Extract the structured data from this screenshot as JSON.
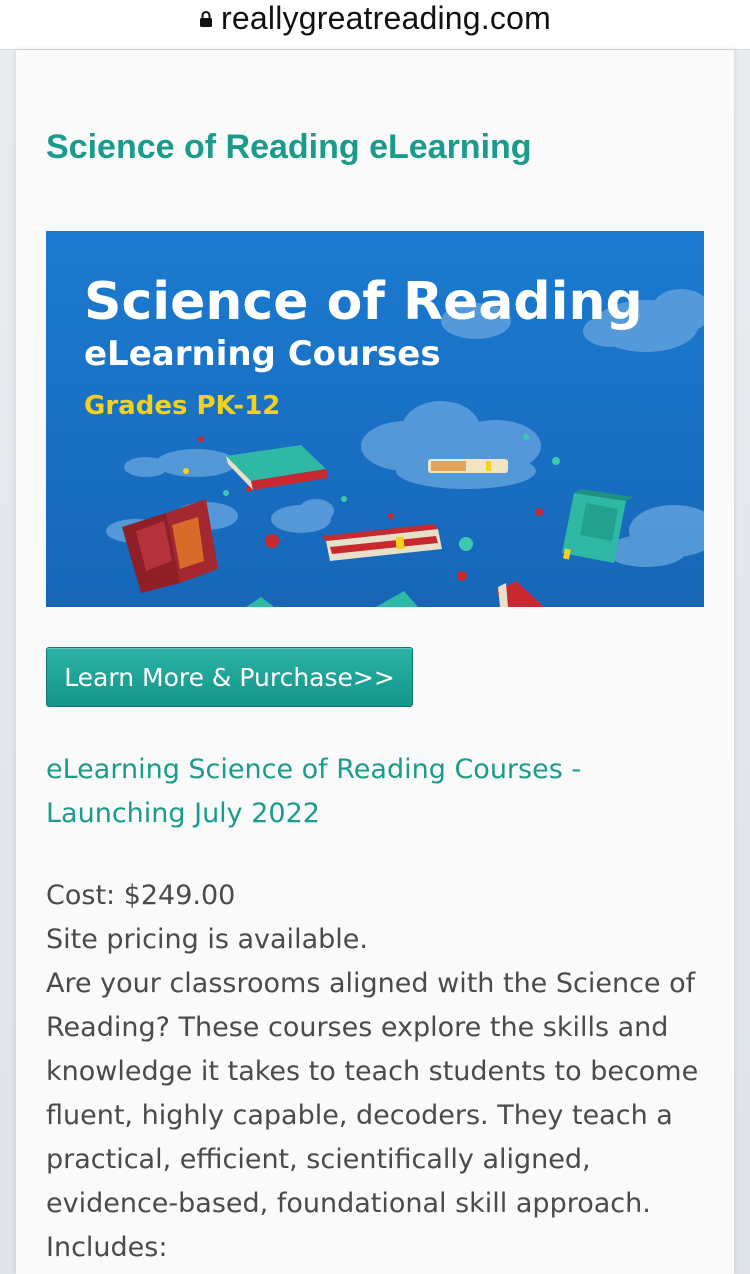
{
  "browser": {
    "url": "reallygreatreading.com"
  },
  "page": {
    "title": "Science of Reading eLearning",
    "banner": {
      "title_line1": "Science of Reading",
      "title_line2": "eLearning Courses",
      "grades": "Grades PK-12"
    },
    "cta_label": "Learn More & Purchase>>",
    "subheading": "eLearning Science of Reading Courses - Launching July 2022",
    "cost": "Cost: $249.00",
    "site_pricing": "Site pricing is available.",
    "description": "Are your classrooms aligned with the Science of Reading? These courses explore the skills and knowledge it takes to teach students to become fluent, highly capable, decoders. They teach a practical, efficient, scientifically aligned, evidence-based, foundational skill approach.",
    "includes": "Includes:"
  },
  "colors": {
    "accent": "#1a9b8c",
    "banner_blue": "#1b74c9",
    "banner_yellow": "#f3d21d",
    "body_text": "#4a4a4a"
  },
  "icons": {
    "lock": "lock-icon"
  }
}
